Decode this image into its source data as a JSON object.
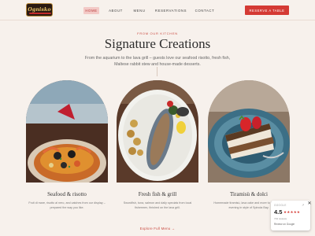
{
  "header": {
    "logo_text": "Ognisko",
    "nav": [
      {
        "label": "HOME",
        "active": true
      },
      {
        "label": "ABOUT",
        "active": false
      },
      {
        "label": "MENU",
        "active": false
      },
      {
        "label": "RESERVATIONS",
        "active": false
      },
      {
        "label": "CONTACT",
        "active": false
      }
    ],
    "cta_label": "RESERVE A TABLE"
  },
  "hero": {
    "eyebrow": "FROM OUR KITCHEN",
    "title": "Signature Creations",
    "subtitle": "From the aquarium to the lava grill – guests love our seafood risotto, fresh fish, Maltese rabbit stew and house-made desserts."
  },
  "cards": [
    {
      "title": "Seafood & risotto",
      "desc": "Fruit di mare, risotto al nero, and catches from our display – prepared the way you like."
    },
    {
      "title": "Fresh fish & grill",
      "desc": "Swordfish, tuna, salmon and daily specials from local fishermen, finished on the lava grill."
    },
    {
      "title": "Tiramisù & dolci",
      "desc": "Homemade tiramisù, lava cake and more to finish your evening in style of Spinola Bay."
    }
  ],
  "explore_label": "Explore Full Menu →",
  "google_widget": {
    "label": "GOOGLE",
    "score": "4.5",
    "stars": "★★★★★",
    "reviews": "719 reviews",
    "cta": "Review on Google"
  },
  "colors": {
    "accent": "#d43a34",
    "background": "#f7f1ec"
  }
}
